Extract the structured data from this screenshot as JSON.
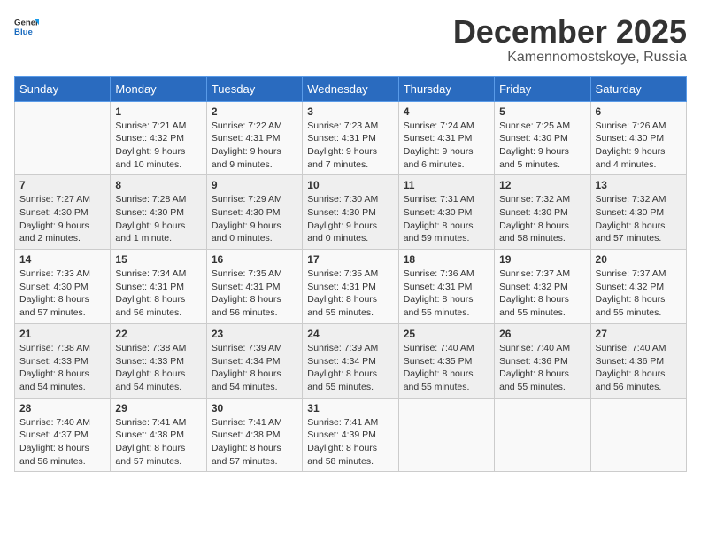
{
  "logo": {
    "general": "General",
    "blue": "Blue"
  },
  "title": "December 2025",
  "subtitle": "Kamennomostskoye, Russia",
  "days_header": [
    "Sunday",
    "Monday",
    "Tuesday",
    "Wednesday",
    "Thursday",
    "Friday",
    "Saturday"
  ],
  "weeks": [
    [
      {
        "day": "",
        "info": ""
      },
      {
        "day": "1",
        "info": "Sunrise: 7:21 AM\nSunset: 4:32 PM\nDaylight: 9 hours\nand 10 minutes."
      },
      {
        "day": "2",
        "info": "Sunrise: 7:22 AM\nSunset: 4:31 PM\nDaylight: 9 hours\nand 9 minutes."
      },
      {
        "day": "3",
        "info": "Sunrise: 7:23 AM\nSunset: 4:31 PM\nDaylight: 9 hours\nand 7 minutes."
      },
      {
        "day": "4",
        "info": "Sunrise: 7:24 AM\nSunset: 4:31 PM\nDaylight: 9 hours\nand 6 minutes."
      },
      {
        "day": "5",
        "info": "Sunrise: 7:25 AM\nSunset: 4:30 PM\nDaylight: 9 hours\nand 5 minutes."
      },
      {
        "day": "6",
        "info": "Sunrise: 7:26 AM\nSunset: 4:30 PM\nDaylight: 9 hours\nand 4 minutes."
      }
    ],
    [
      {
        "day": "7",
        "info": "Sunrise: 7:27 AM\nSunset: 4:30 PM\nDaylight: 9 hours\nand 2 minutes."
      },
      {
        "day": "8",
        "info": "Sunrise: 7:28 AM\nSunset: 4:30 PM\nDaylight: 9 hours\nand 1 minute."
      },
      {
        "day": "9",
        "info": "Sunrise: 7:29 AM\nSunset: 4:30 PM\nDaylight: 9 hours\nand 0 minutes."
      },
      {
        "day": "10",
        "info": "Sunrise: 7:30 AM\nSunset: 4:30 PM\nDaylight: 9 hours\nand 0 minutes."
      },
      {
        "day": "11",
        "info": "Sunrise: 7:31 AM\nSunset: 4:30 PM\nDaylight: 8 hours\nand 59 minutes."
      },
      {
        "day": "12",
        "info": "Sunrise: 7:32 AM\nSunset: 4:30 PM\nDaylight: 8 hours\nand 58 minutes."
      },
      {
        "day": "13",
        "info": "Sunrise: 7:32 AM\nSunset: 4:30 PM\nDaylight: 8 hours\nand 57 minutes."
      }
    ],
    [
      {
        "day": "14",
        "info": "Sunrise: 7:33 AM\nSunset: 4:30 PM\nDaylight: 8 hours\nand 57 minutes."
      },
      {
        "day": "15",
        "info": "Sunrise: 7:34 AM\nSunset: 4:31 PM\nDaylight: 8 hours\nand 56 minutes."
      },
      {
        "day": "16",
        "info": "Sunrise: 7:35 AM\nSunset: 4:31 PM\nDaylight: 8 hours\nand 56 minutes."
      },
      {
        "day": "17",
        "info": "Sunrise: 7:35 AM\nSunset: 4:31 PM\nDaylight: 8 hours\nand 55 minutes."
      },
      {
        "day": "18",
        "info": "Sunrise: 7:36 AM\nSunset: 4:31 PM\nDaylight: 8 hours\nand 55 minutes."
      },
      {
        "day": "19",
        "info": "Sunrise: 7:37 AM\nSunset: 4:32 PM\nDaylight: 8 hours\nand 55 minutes."
      },
      {
        "day": "20",
        "info": "Sunrise: 7:37 AM\nSunset: 4:32 PM\nDaylight: 8 hours\nand 55 minutes."
      }
    ],
    [
      {
        "day": "21",
        "info": "Sunrise: 7:38 AM\nSunset: 4:33 PM\nDaylight: 8 hours\nand 54 minutes."
      },
      {
        "day": "22",
        "info": "Sunrise: 7:38 AM\nSunset: 4:33 PM\nDaylight: 8 hours\nand 54 minutes."
      },
      {
        "day": "23",
        "info": "Sunrise: 7:39 AM\nSunset: 4:34 PM\nDaylight: 8 hours\nand 54 minutes."
      },
      {
        "day": "24",
        "info": "Sunrise: 7:39 AM\nSunset: 4:34 PM\nDaylight: 8 hours\nand 55 minutes."
      },
      {
        "day": "25",
        "info": "Sunrise: 7:40 AM\nSunset: 4:35 PM\nDaylight: 8 hours\nand 55 minutes."
      },
      {
        "day": "26",
        "info": "Sunrise: 7:40 AM\nSunset: 4:36 PM\nDaylight: 8 hours\nand 55 minutes."
      },
      {
        "day": "27",
        "info": "Sunrise: 7:40 AM\nSunset: 4:36 PM\nDaylight: 8 hours\nand 56 minutes."
      }
    ],
    [
      {
        "day": "28",
        "info": "Sunrise: 7:40 AM\nSunset: 4:37 PM\nDaylight: 8 hours\nand 56 minutes."
      },
      {
        "day": "29",
        "info": "Sunrise: 7:41 AM\nSunset: 4:38 PM\nDaylight: 8 hours\nand 57 minutes."
      },
      {
        "day": "30",
        "info": "Sunrise: 7:41 AM\nSunset: 4:38 PM\nDaylight: 8 hours\nand 57 minutes."
      },
      {
        "day": "31",
        "info": "Sunrise: 7:41 AM\nSunset: 4:39 PM\nDaylight: 8 hours\nand 58 minutes."
      },
      {
        "day": "",
        "info": ""
      },
      {
        "day": "",
        "info": ""
      },
      {
        "day": "",
        "info": ""
      }
    ]
  ]
}
